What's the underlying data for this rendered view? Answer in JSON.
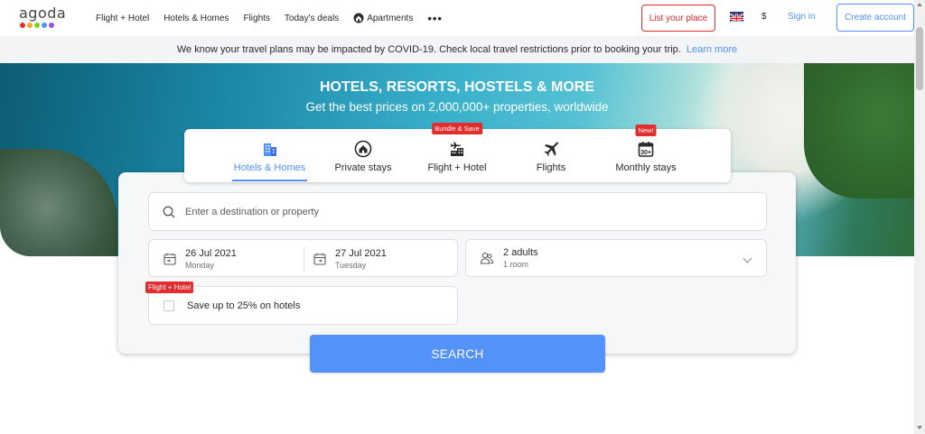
{
  "brand": {
    "name": "agoda",
    "dot_colors": [
      "#e12d2d",
      "#f5a623",
      "#7ed321",
      "#5392f9",
      "#9b51e0",
      "#2bb0a0"
    ]
  },
  "nav": {
    "items": [
      {
        "label": "Flight + Hotel"
      },
      {
        "label": "Hotels & Homes"
      },
      {
        "label": "Flights"
      },
      {
        "label": "Today's deals"
      },
      {
        "label": "Apartments",
        "icon": "apartment-icon"
      }
    ],
    "more": "•••"
  },
  "header": {
    "list_place": "List your place",
    "currency": "$",
    "sign_in": "Sign in",
    "create_account": "Create account",
    "language_icon": "uk-flag-icon"
  },
  "banner": {
    "text": "We know your travel plans may be impacted by COVID-19. Check local travel restrictions prior to booking your trip.",
    "link": "Learn more"
  },
  "hero": {
    "title": "HOTELS, RESORTS, HOSTELS & MORE",
    "subtitle": "Get the best prices on 2,000,000+ properties, worldwide"
  },
  "tabs": [
    {
      "label": "Hotels & Homes",
      "icon": "building-icon",
      "active": true,
      "badge": ""
    },
    {
      "label": "Private stays",
      "icon": "house-icon",
      "active": false,
      "badge": ""
    },
    {
      "label": "Flight + Hotel",
      "icon": "flight-hotel-icon",
      "active": false,
      "badge": "Bundle & Save"
    },
    {
      "label": "Flights",
      "icon": "plane-icon",
      "active": false,
      "badge": ""
    },
    {
      "label": "Monthly stays",
      "icon": "calendar-30-icon",
      "active": false,
      "badge": "New!"
    }
  ],
  "search": {
    "destination_placeholder": "Enter a destination or property",
    "checkin_date": "26 Jul 2021",
    "checkin_day": "Monday",
    "checkout_date": "27 Jul 2021",
    "checkout_day": "Tuesday",
    "guests": "2 adults",
    "rooms": "1 room",
    "bundle_badge": "Flight + Hotel",
    "bundle_text": "Save up to 25% on hotels",
    "bundle_checked": false,
    "button": "SEARCH"
  },
  "colors": {
    "accent": "#5392f9",
    "badge_red": "#e12d2d"
  }
}
